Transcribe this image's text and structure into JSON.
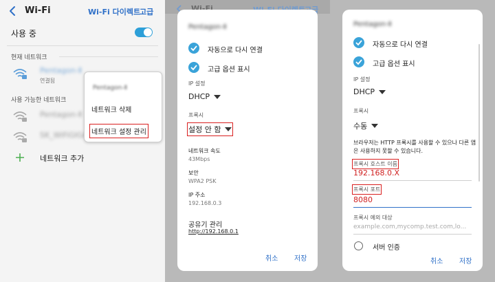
{
  "panel1": {
    "header": {
      "title": "Wi-Fi",
      "wifi_direct": "Wi-Fi 다이렉트",
      "advanced": "고급"
    },
    "toggle_label": "사용 중",
    "current_section": "현재 네트워크",
    "current_network": {
      "name": "Pentagon-Ⅱ",
      "status": "연결됨"
    },
    "available_section": "사용 가능한 네트워크",
    "available_networks": [
      {
        "name": "Pentagon-Ⅱ"
      },
      {
        "name": "SK_WiFiGIGA"
      }
    ],
    "add_network": "네트워크 추가",
    "context_menu": {
      "title": "Pentagon-Ⅱ",
      "forget": "네트워크 삭제",
      "manage": "네트워크 설정 관리"
    }
  },
  "panel2": {
    "background": {
      "title": "Wi-Fi",
      "wifi_direct": "Wi-Fi 다이렉트",
      "advanced": "고급"
    },
    "dialog": {
      "title": "Pentagon-Ⅱ",
      "auto_reconnect": "자동으로 다시 연결",
      "show_advanced": "고급 옵션 표시",
      "ip_label": "IP 설정",
      "ip_value": "DHCP",
      "proxy_label": "프록시",
      "proxy_value": "설정 안 함",
      "link_speed_label": "네트워크 속도",
      "link_speed_value": "43Mbps",
      "security_label": "보안",
      "security_value": "WPA2 PSK",
      "ip_address_label": "IP 주소",
      "ip_address_value": "192.168.0.3",
      "router_label": "공유기 관리",
      "router_link": "http://192.168.0.1",
      "cancel": "취소",
      "save": "저장"
    }
  },
  "panel3": {
    "dialog": {
      "title": "Pentagon-Ⅱ",
      "auto_reconnect": "자동으로 다시 연결",
      "show_advanced": "고급 옵션 표시",
      "ip_label": "IP 설정",
      "ip_value": "DHCP",
      "proxy_label": "프록시",
      "proxy_value": "수동",
      "proxy_desc": "브라우저는 HTTP 프록시를 사용할 수 있으나 다른 앱은 사용하지 못할 수 있습니다.",
      "host_label": "프록시 호스트 이름",
      "host_value": "192.168.0.X",
      "port_label": "프록시 포트",
      "port_value": "8080",
      "bypass_label": "프록시 예외 대상",
      "bypass_placeholder": "example.com,mycomp.test.com,lo...",
      "partial_option": "서버 인증",
      "cancel": "취소",
      "save": "저장"
    }
  },
  "colors": {
    "accent": "#2f70c8",
    "toggle": "#2d9fd8",
    "highlight": "#d91e1e",
    "check": "#3aa3d9"
  }
}
